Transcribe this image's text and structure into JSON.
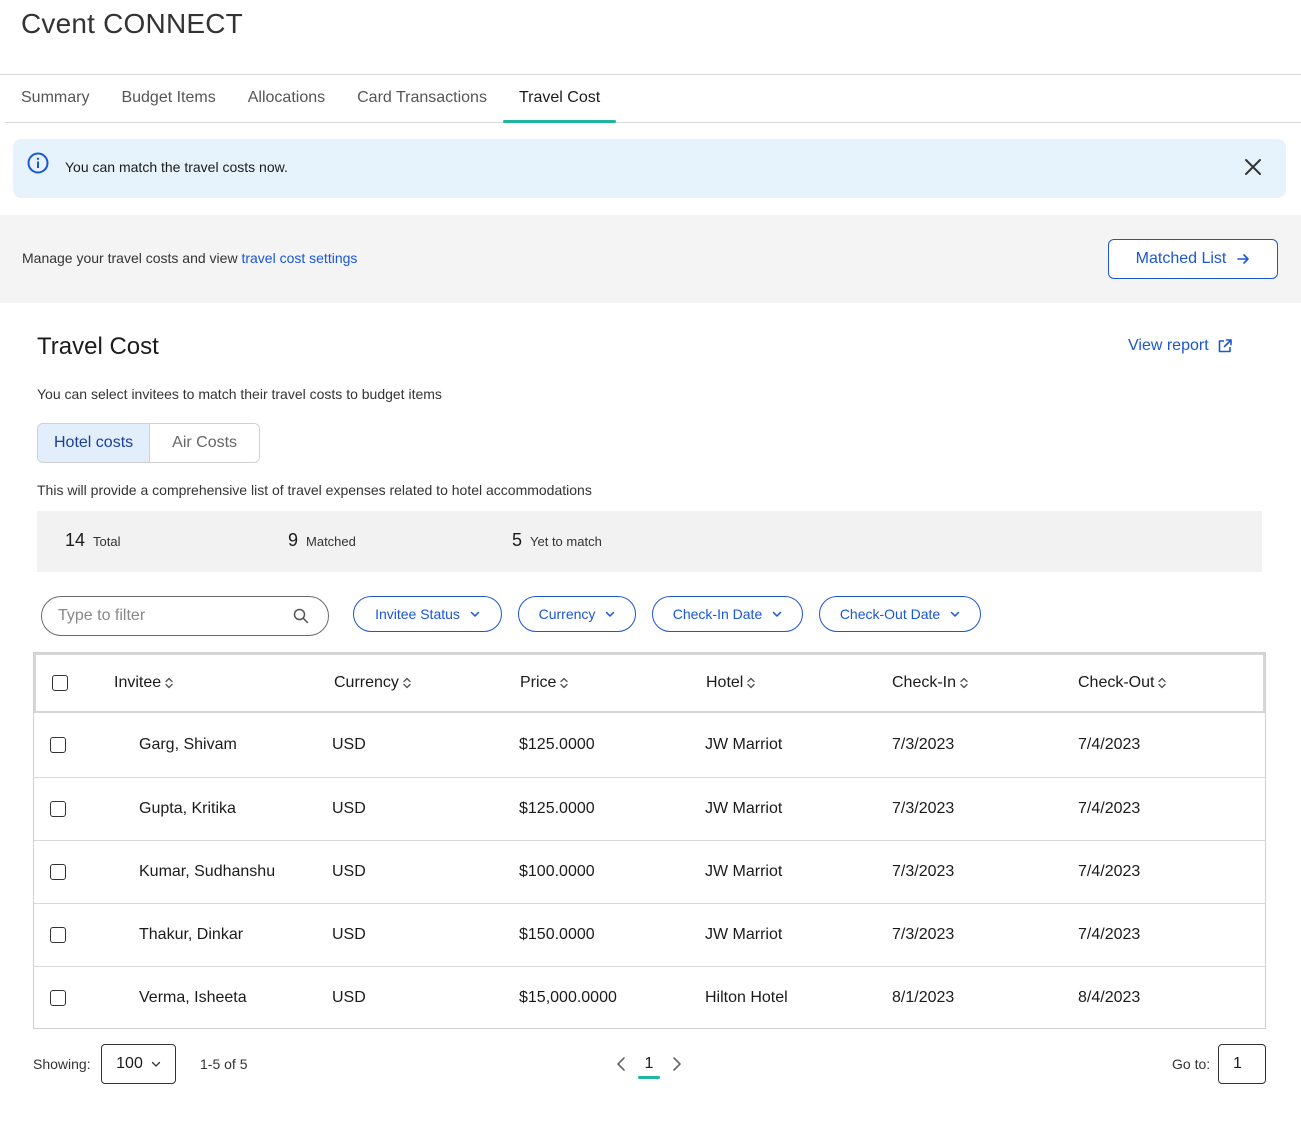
{
  "app": {
    "title": "Cvent CONNECT"
  },
  "tabs": [
    {
      "label": "Summary",
      "active": false
    },
    {
      "label": "Budget Items",
      "active": false
    },
    {
      "label": "Allocations",
      "active": false
    },
    {
      "label": "Card Transactions",
      "active": false
    },
    {
      "label": "Travel Cost",
      "active": true
    }
  ],
  "alert": {
    "icon": "info-icon",
    "message": "You can match the travel costs now.",
    "close_icon": "close-icon"
  },
  "manage": {
    "text": "Manage your travel costs and view ",
    "link": "travel cost settings",
    "matched_button": "Matched List",
    "matched_button_icon": "arrow-right-icon"
  },
  "section": {
    "title": "Travel Cost",
    "view_report": "View report",
    "view_report_icon": "external-link-icon",
    "description": "You can select invitees to match their travel costs to budget items"
  },
  "toggle": {
    "options": [
      "Hotel costs",
      "Air Costs"
    ],
    "selected": "Hotel costs",
    "description": "This will provide a comprehensive list of travel expenses related to hotel accommodations"
  },
  "stats": {
    "total": {
      "value": "14",
      "label": "Total"
    },
    "matched": {
      "value": "9",
      "label": "Matched"
    },
    "yet_to_match": {
      "value": "5",
      "label": "Yet to match"
    }
  },
  "filters": {
    "search_placeholder": "Type to filter",
    "search_value": "",
    "chips": [
      "Invitee Status",
      "Currency",
      "Check-In Date",
      "Check-Out Date"
    ]
  },
  "table": {
    "columns": [
      "Invitee",
      "Currency",
      "Price",
      "Hotel",
      "Check-In",
      "Check-Out"
    ],
    "rows": [
      {
        "invitee": "Garg, Shivam",
        "currency": "USD",
        "price": "$125.0000",
        "hotel": "JW Marriot",
        "checkin": "7/3/2023",
        "checkout": "7/4/2023"
      },
      {
        "invitee": "Gupta, Kritika",
        "currency": "USD",
        "price": "$125.0000",
        "hotel": "JW Marriot",
        "checkin": "7/3/2023",
        "checkout": "7/4/2023"
      },
      {
        "invitee": "Kumar, Sudhanshu",
        "currency": "USD",
        "price": "$100.0000",
        "hotel": "JW Marriot",
        "checkin": "7/3/2023",
        "checkout": "7/4/2023"
      },
      {
        "invitee": "Thakur, Dinkar",
        "currency": "USD",
        "price": "$150.0000",
        "hotel": "JW Marriot",
        "checkin": "7/3/2023",
        "checkout": "7/4/2023"
      },
      {
        "invitee": "Verma, Isheeta",
        "currency": "USD",
        "price": "$15,000.0000",
        "hotel": "Hilton Hotel",
        "checkin": "8/1/2023",
        "checkout": "8/4/2023"
      }
    ]
  },
  "pagination": {
    "showing_label": "Showing:",
    "page_size": "100",
    "range": "1-5 of 5",
    "current_page": "1",
    "goto_label": "Go to:",
    "goto_value": "1"
  },
  "colors": {
    "accent_teal": "#1fb5a0",
    "link_blue": "#1a56d6",
    "alert_bg": "#e6f3fd"
  }
}
